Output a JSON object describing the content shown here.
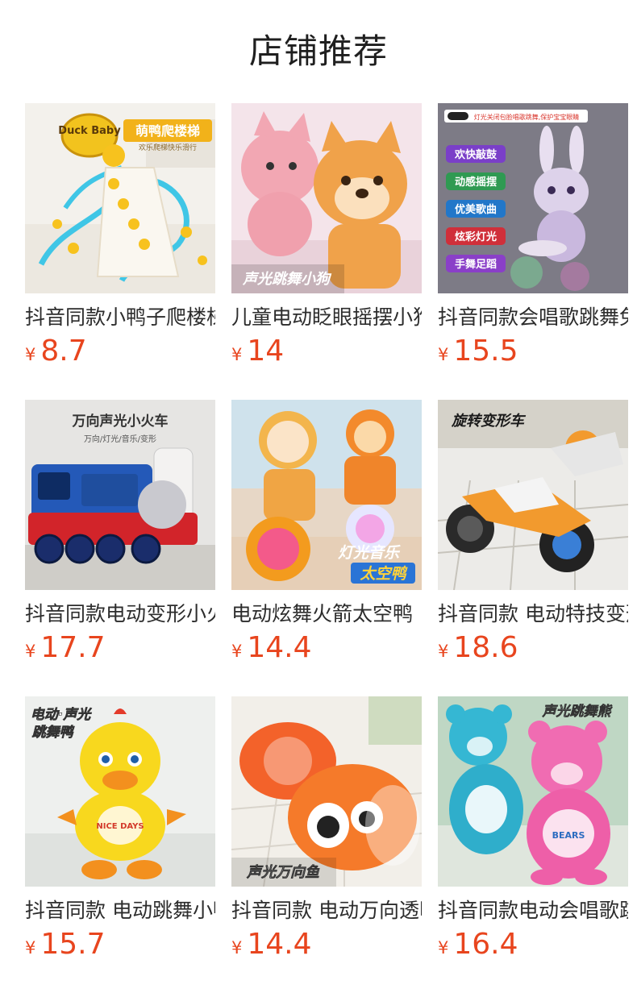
{
  "page": {
    "title": "店铺推荐"
  },
  "products": [
    {
      "name": "抖音同款小鸭子爬楼梯",
      "currency": "¥",
      "price": "8.7",
      "image_label": "萌鸭爬楼梯",
      "image_sublabel": "欢乐爬梯快乐滑行",
      "image_logo": "Duck Baby",
      "icon": "duck-stairs-image"
    },
    {
      "name": "儿童电动眨眼摇摆小狗",
      "currency": "¥",
      "price": "14",
      "image_label": "声光跳舞小狗",
      "icon": "dancing-dog-image"
    },
    {
      "name": "抖音同款会唱歌跳舞兔子",
      "currency": "¥",
      "price": "15.5",
      "image_banner": "灯光关闭包脸唱歌跳舞,保护宝宝眼睛",
      "image_tags": [
        "欢快敲鼓",
        "动感摇摆",
        "优美歌曲",
        "炫彩灯光",
        "手舞足蹈"
      ],
      "icon": "drum-rabbit-image"
    },
    {
      "name": "抖音同款电动变形小火车",
      "currency": "¥",
      "price": "17.7",
      "image_label": "万向声光小火车",
      "image_sublabel": "万向/灯光/音乐/变形",
      "icon": "toy-train-image"
    },
    {
      "name": "电动炫舞火箭太空鸭",
      "currency": "¥",
      "price": "14.4",
      "image_label": "灯光音乐",
      "image_label2": "太空鸭",
      "icon": "space-duck-image"
    },
    {
      "name": "抖音同款 电动特技变形摩托",
      "currency": "¥",
      "price": "18.6",
      "image_label": "旋转变形车",
      "icon": "stunt-motorcycle-image"
    },
    {
      "name": "抖音同款 电动跳舞小鸭",
      "currency": "¥",
      "price": "15.7",
      "image_label": "电动·声光",
      "image_label2": "跳舞鸭",
      "image_badge": "NICE DAYS",
      "icon": "dancing-duck-image"
    },
    {
      "name": "抖音同款 电动万向透明鱼",
      "currency": "¥",
      "price": "14.4",
      "image_label": "声光万向鱼",
      "icon": "clownfish-image"
    },
    {
      "name": "抖音同款电动会唱歌跳舞熊",
      "currency": "¥",
      "price": "16.4",
      "image_label": "声光跳舞熊",
      "image_badge": "BEARS",
      "icon": "dancing-bear-image"
    }
  ],
  "colors": {
    "price": "#e8451e",
    "title": "#1f1f1f",
    "text": "#2c2c2c"
  }
}
